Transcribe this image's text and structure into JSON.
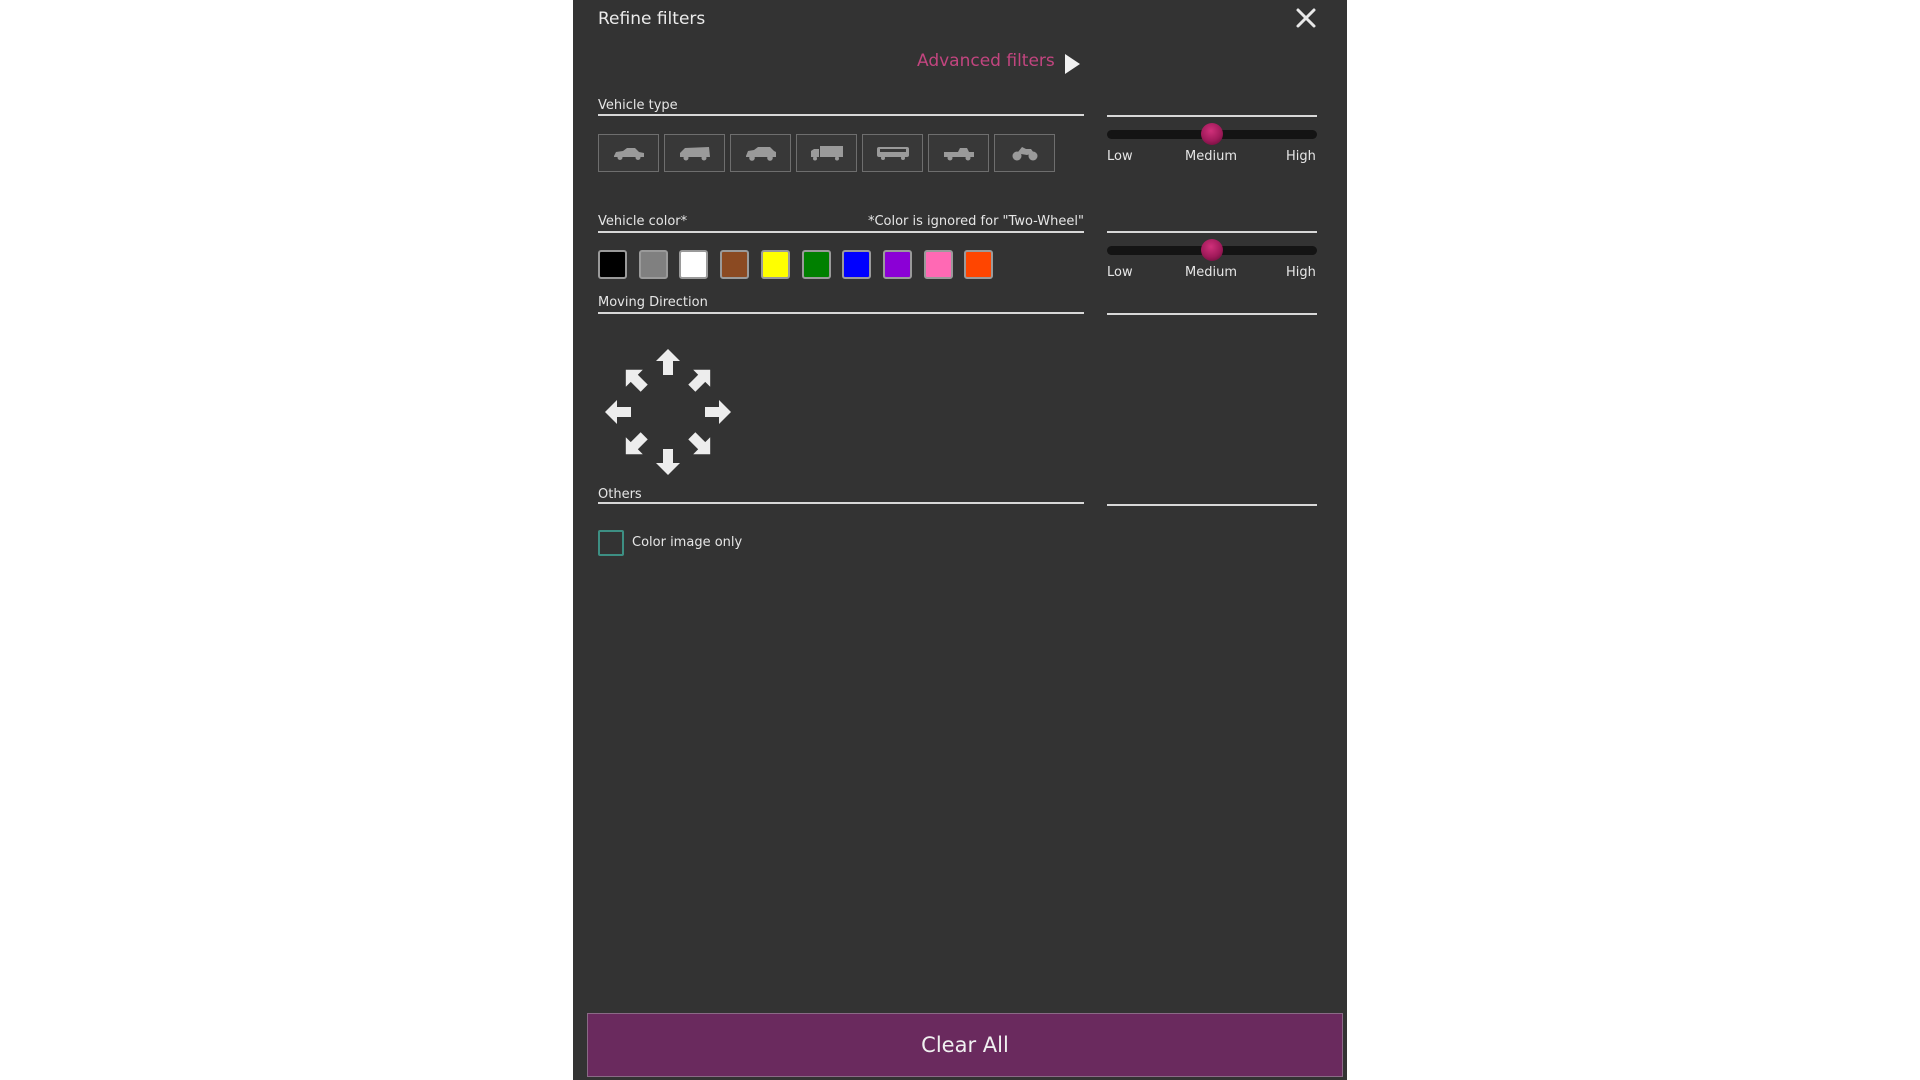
{
  "header": {
    "title": "Refine filters",
    "close_icon": "close-icon",
    "advanced_filters_label": "Advanced filters",
    "advanced_filters_icon": "play-triangle-icon"
  },
  "vehicle_type": {
    "label": "Vehicle type",
    "types": [
      {
        "name": "sedan",
        "icon": "sedan-icon"
      },
      {
        "name": "van",
        "icon": "van-icon"
      },
      {
        "name": "suv",
        "icon": "suv-icon"
      },
      {
        "name": "truck",
        "icon": "truck-icon"
      },
      {
        "name": "bus",
        "icon": "bus-icon"
      },
      {
        "name": "pickup",
        "icon": "pickup-icon"
      },
      {
        "name": "two-wheel",
        "icon": "motorcycle-icon"
      }
    ],
    "slider": {
      "labels": [
        "Low",
        "Medium",
        "High"
      ],
      "value": "Medium",
      "fraction": 0.5
    }
  },
  "vehicle_color": {
    "label": "Vehicle color*",
    "note": "*Color is ignored for \"Two-Wheel\"",
    "colors": [
      {
        "name": "black",
        "hex": "#000000"
      },
      {
        "name": "gray",
        "hex": "#808080"
      },
      {
        "name": "white",
        "hex": "#ffffff"
      },
      {
        "name": "brown",
        "hex": "#8b4a22"
      },
      {
        "name": "yellow",
        "hex": "#ffff00"
      },
      {
        "name": "green",
        "hex": "#008000"
      },
      {
        "name": "blue",
        "hex": "#0000ff"
      },
      {
        "name": "purple",
        "hex": "#8b00d6"
      },
      {
        "name": "pink",
        "hex": "#ff69b4"
      },
      {
        "name": "orange",
        "hex": "#ff4500"
      }
    ],
    "slider": {
      "labels": [
        "Low",
        "Medium",
        "High"
      ],
      "value": "Medium",
      "fraction": 0.5
    }
  },
  "moving_direction": {
    "label": "Moving Direction",
    "directions": [
      "up",
      "up-right",
      "right",
      "down-right",
      "down",
      "down-left",
      "left",
      "up-left"
    ]
  },
  "others": {
    "label": "Others",
    "color_image_only": {
      "label": "Color image only",
      "checked": false
    }
  },
  "footer": {
    "clear_all_label": "Clear All"
  },
  "colors": {
    "panel_bg": "#333333",
    "accent": "#c2457f",
    "button_bg": "#6a2a5e",
    "slider_thumb": "#a01a5a",
    "checkbox_border": "#3d8f83"
  }
}
